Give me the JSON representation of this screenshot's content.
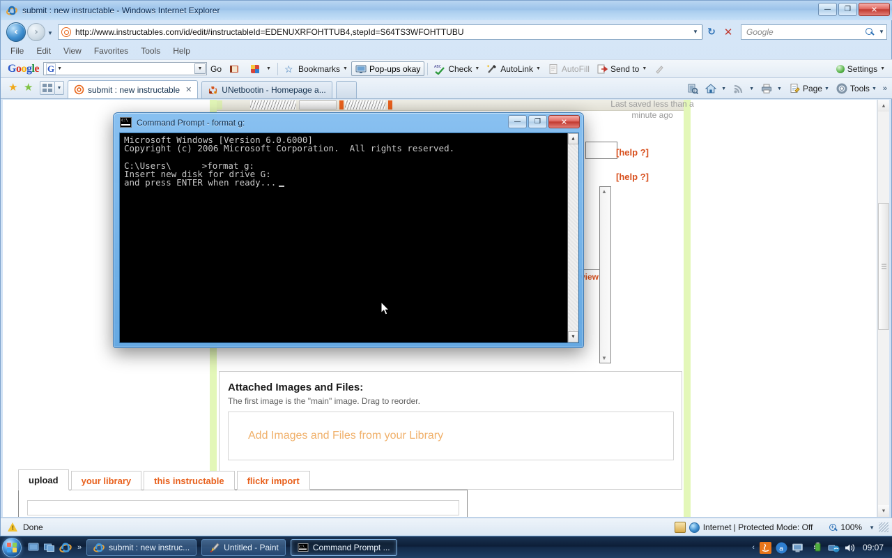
{
  "window": {
    "title": "submit : new instructable - Windows Internet Explorer",
    "minimize": "0",
    "maximize": "1",
    "close": "r"
  },
  "address_bar": {
    "url": "http://www.instructables.com/id/edit#instructableId=EDENUXRFOHTTUB4,stepId=S64TS3WFOHTTUBU",
    "dropdown_caret": "▼",
    "refresh_label": "↻",
    "stop_label": "✕"
  },
  "search": {
    "placeholder": "Google",
    "caret": "▼"
  },
  "menu": {
    "items": [
      "File",
      "Edit",
      "View",
      "Favorites",
      "Tools",
      "Help"
    ]
  },
  "google_toolbar": {
    "logo": {
      "g1": "G",
      "o1": "o",
      "o2": "o",
      "g2": "g",
      "l": "l",
      "e": "e"
    },
    "input_value": "",
    "input_mark": "G",
    "go_label": "Go",
    "bookmarks_label": "Bookmarks",
    "popups_label": "Pop-ups okay",
    "check_label": "Check",
    "autolink_label": "AutoLink",
    "autofill_label": "AutoFill",
    "sendto_label": "Send to",
    "settings_label": "Settings",
    "caret": "▼"
  },
  "tabs": [
    {
      "label": "submit : new instructable",
      "active": true,
      "close": "✕"
    },
    {
      "label": "UNetbootin - Homepage a...",
      "active": false,
      "close": ""
    }
  ],
  "tab_toolbar": {
    "page_label": "Page",
    "tools_label": "Tools",
    "overflow": "»",
    "caret": "▼"
  },
  "page": {
    "last_saved": "Last saved less than a minute ago",
    "help_1": "[help ?]",
    "help_2": "[help ?]",
    "preview_tab": "view",
    "attached": {
      "heading": "Attached Images and Files:",
      "subtitle": "The first image is the \"main\" image. Drag to reorder.",
      "dropzone_label": "Add Images and Files from your Library",
      "tabs": [
        {
          "label": "upload",
          "active": true
        },
        {
          "label": "your library",
          "active": false
        },
        {
          "label": "this instructable",
          "active": false
        },
        {
          "label": "flickr import",
          "active": false
        }
      ]
    }
  },
  "cmd": {
    "title": "Command Prompt - format  g:",
    "line1": "Microsoft Windows [Version 6.0.6000]",
    "line2": "Copyright (c) 2006 Microsoft Corporation.  All rights reserved.",
    "line3_prefix": "C:\\Users\\",
    "line3_suffix": ">format g:",
    "line4": "Insert new disk for drive G:",
    "line5": "and press ENTER when ready...",
    "minimize": "0",
    "maximize": "1",
    "close": "r",
    "scroll_up": "▲",
    "scroll_down": "▼"
  },
  "status_bar": {
    "text": "Done",
    "zone": "Internet | Protected Mode: Off",
    "zoom": "100%",
    "zoom_caret": "▼"
  },
  "taskbar": {
    "buttons": [
      {
        "label": "submit : new instruc...",
        "active": false,
        "icon": "ie-icon"
      },
      {
        "label": "Untitled - Paint",
        "active": false,
        "icon": "paint-icon"
      },
      {
        "label": "Command Prompt ...",
        "active": true,
        "icon": "cmd-icon"
      }
    ],
    "quicklaunch_chevron": "»",
    "tray_chevron": "‹",
    "clock": "09:07"
  },
  "colors": {
    "accent_orange": "#e8601c",
    "page_green": "#e3f7b8",
    "cmd_black": "#000000",
    "taskbar_blue": "#1a3a63"
  }
}
